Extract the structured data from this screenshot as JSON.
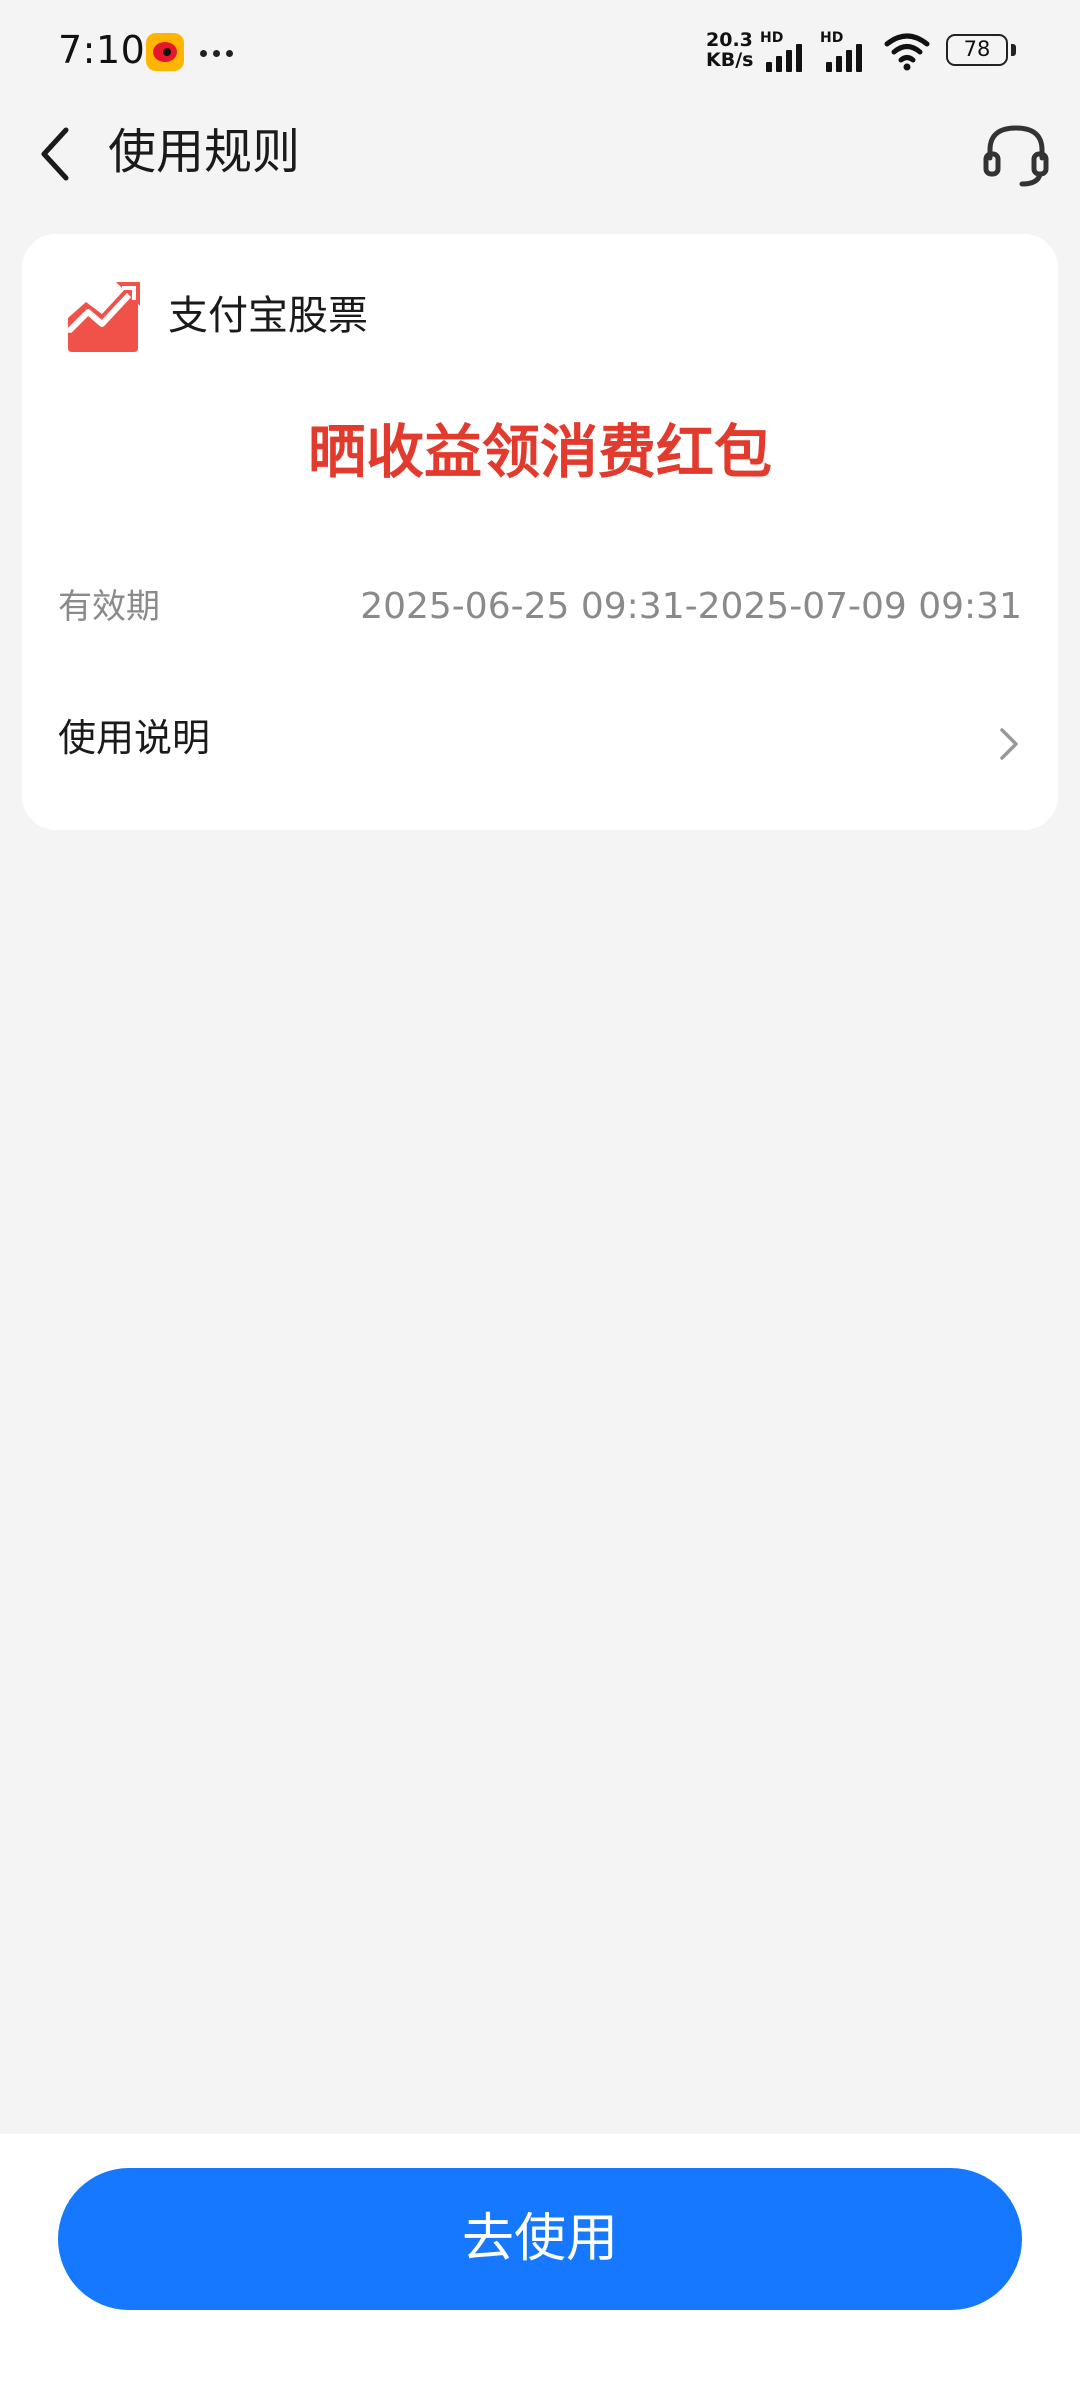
{
  "status_bar": {
    "time": "7:10",
    "net_speed_value": "20.3",
    "net_speed_unit": "KB/s",
    "signal1_label": "HD",
    "signal2_label": "HD",
    "battery": "78"
  },
  "nav": {
    "title": "使用规则"
  },
  "card": {
    "brand_name": "支付宝股票",
    "coupon_title": "晒收益领消费红包",
    "validity_label": "有效期",
    "validity_value": "2025-06-25 09:31-2025-07-09 09:31",
    "instructions_label": "使用说明"
  },
  "footer": {
    "use_button_label": "去使用"
  },
  "colors": {
    "accent": "#1677ff",
    "coupon_red": "#e23b2e",
    "brand_logo": "#f0524a",
    "background": "#f4f4f4"
  },
  "icons": {
    "back": "back-arrow-icon",
    "support": "headset-icon",
    "brand": "stock-chart-logo-icon",
    "chevron": "chevron-right-icon"
  }
}
